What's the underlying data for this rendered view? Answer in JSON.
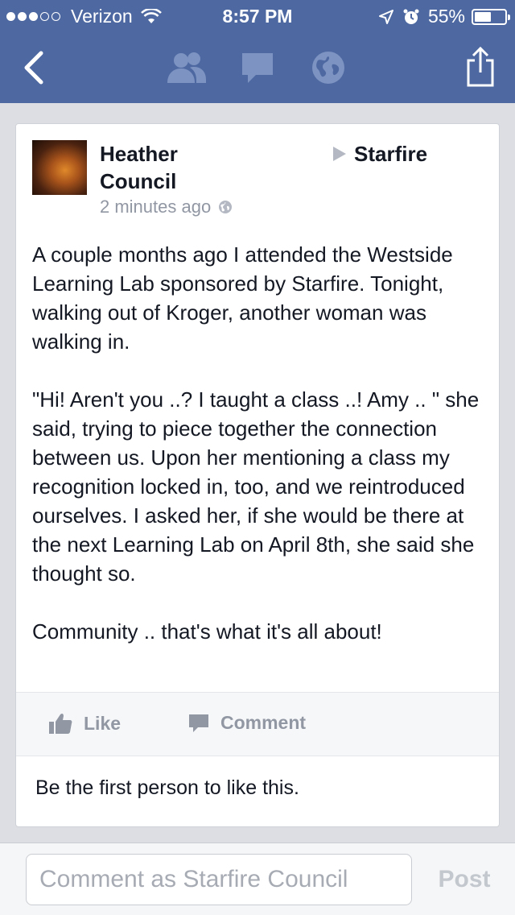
{
  "status_bar": {
    "carrier": "Verizon",
    "time": "8:57 PM",
    "battery": "55%",
    "battery_level": 0.55,
    "signal_bars": 3,
    "signal_total": 5
  },
  "nav": {
    "back_icon": "chevron-left-icon",
    "friends_icon": "friends-icon",
    "messages_icon": "message-bubble-icon",
    "notifications_icon": "globe-icon",
    "share_icon": "share-icon"
  },
  "post": {
    "author_line1": "Heather",
    "author_line2": "Council",
    "target": "Starfire",
    "timestamp": "2 minutes ago",
    "paragraphs": [
      "A couple months ago I attended the Westside Learning Lab sponsored by Starfire.  Tonight, walking out of Kroger, another woman was walking in.",
      "\"Hi!  Aren't you ..?  I taught a class ..!  Amy .. \" she said, trying to piece together the connection between us.  Upon her mentioning a class my recognition locked in, too, and we reintroduced ourselves.  I asked her, if she would be there at the next Learning Lab on April 8th, she said she thought so.",
      "Community .. that's what it's all about!"
    ],
    "like_label": "Like",
    "comment_label": "Comment",
    "likes_text": "Be the first person to like this."
  },
  "comment_bar": {
    "placeholder": "Comment as Starfire Council",
    "value": "",
    "post_label": "Post"
  },
  "colors": {
    "header": "#4e69a2",
    "action_text": "#9197a3",
    "page_bg": "#dcdee3"
  }
}
